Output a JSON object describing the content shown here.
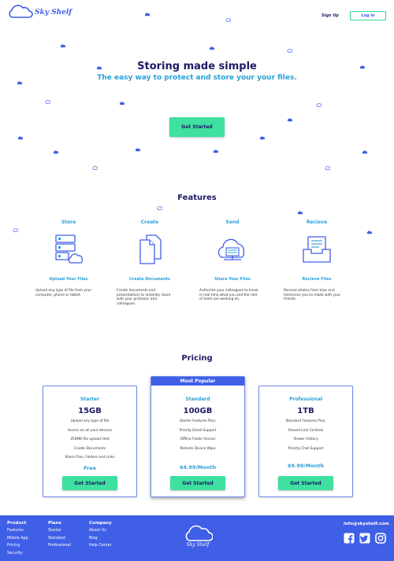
{
  "header": {
    "logo_text": "Sky Shelf",
    "signup_label": "Sign Up",
    "login_label": "Log in"
  },
  "hero": {
    "title": "Storing made simple",
    "subtitle": "The easy way to protect and store your your files.",
    "cta_label": "Get Started"
  },
  "features": {
    "title": "Features",
    "items": [
      {
        "title": "Store",
        "icon": "server-cloud-icon",
        "subtitle": "Upload Your Files",
        "desc": "Upload any type of file from your computer, phone or tablet."
      },
      {
        "title": "Create",
        "icon": "documents-icon",
        "subtitle": "Create Documents",
        "desc": "Create documents and presentations to instantly share with your professor and colleagues."
      },
      {
        "title": "Send",
        "icon": "cloud-share-icon",
        "subtitle": "Share Your Files",
        "desc": "Authorize your colleagues to know in real time what you and the rest of team are working on."
      },
      {
        "title": "Recieve",
        "icon": "inbox-icon",
        "subtitle": "Recieve Files",
        "desc": "Receive photos from trips and memories you've made with your friends."
      }
    ]
  },
  "pricing": {
    "title": "Pricing",
    "plans": [
      {
        "name": "Starter",
        "size": "15GB",
        "features": [
          "Upload any type of file",
          "Access on all your devices",
          "250MB file upload limit",
          "Create Documents",
          "Share Files, Folders and Links"
        ],
        "price": "Free",
        "button": "Get Started"
      },
      {
        "badge": "Most Popular",
        "name": "Standard",
        "size": "100GB",
        "features": [
          "Starter Features Plus:",
          "Priority Email Support",
          "Offline Folder Access",
          "Remote Device Wipe"
        ],
        "price": "$4.99/Month",
        "button": "Get Started"
      },
      {
        "name": "Professional",
        "size": "1TB",
        "features": [
          "Standard Features Plus:",
          "Shared Link Controls",
          "Viewer History",
          "Priority Chat Support"
        ],
        "price": "$9.99/Month",
        "button": "Get Started"
      }
    ]
  },
  "footer": {
    "columns": [
      {
        "title": "Product",
        "items": [
          "Features",
          "Mobile App",
          "Pricing",
          "Security"
        ]
      },
      {
        "title": "Plans",
        "items": [
          "Starter",
          "Standard",
          "Professional"
        ]
      },
      {
        "title": "Company",
        "items": [
          "About Us",
          "Blog",
          "Help Center"
        ]
      }
    ],
    "logo_text": "Sky Shelf",
    "email": "info@skyshelf.com",
    "social": [
      "facebook-icon",
      "twitter-icon",
      "instagram-icon"
    ]
  },
  "colors": {
    "brand_blue": "#3f5fe6",
    "navy": "#1e1a66",
    "accent_green": "#3fe0a0",
    "light_blue": "#2a9fd8"
  }
}
